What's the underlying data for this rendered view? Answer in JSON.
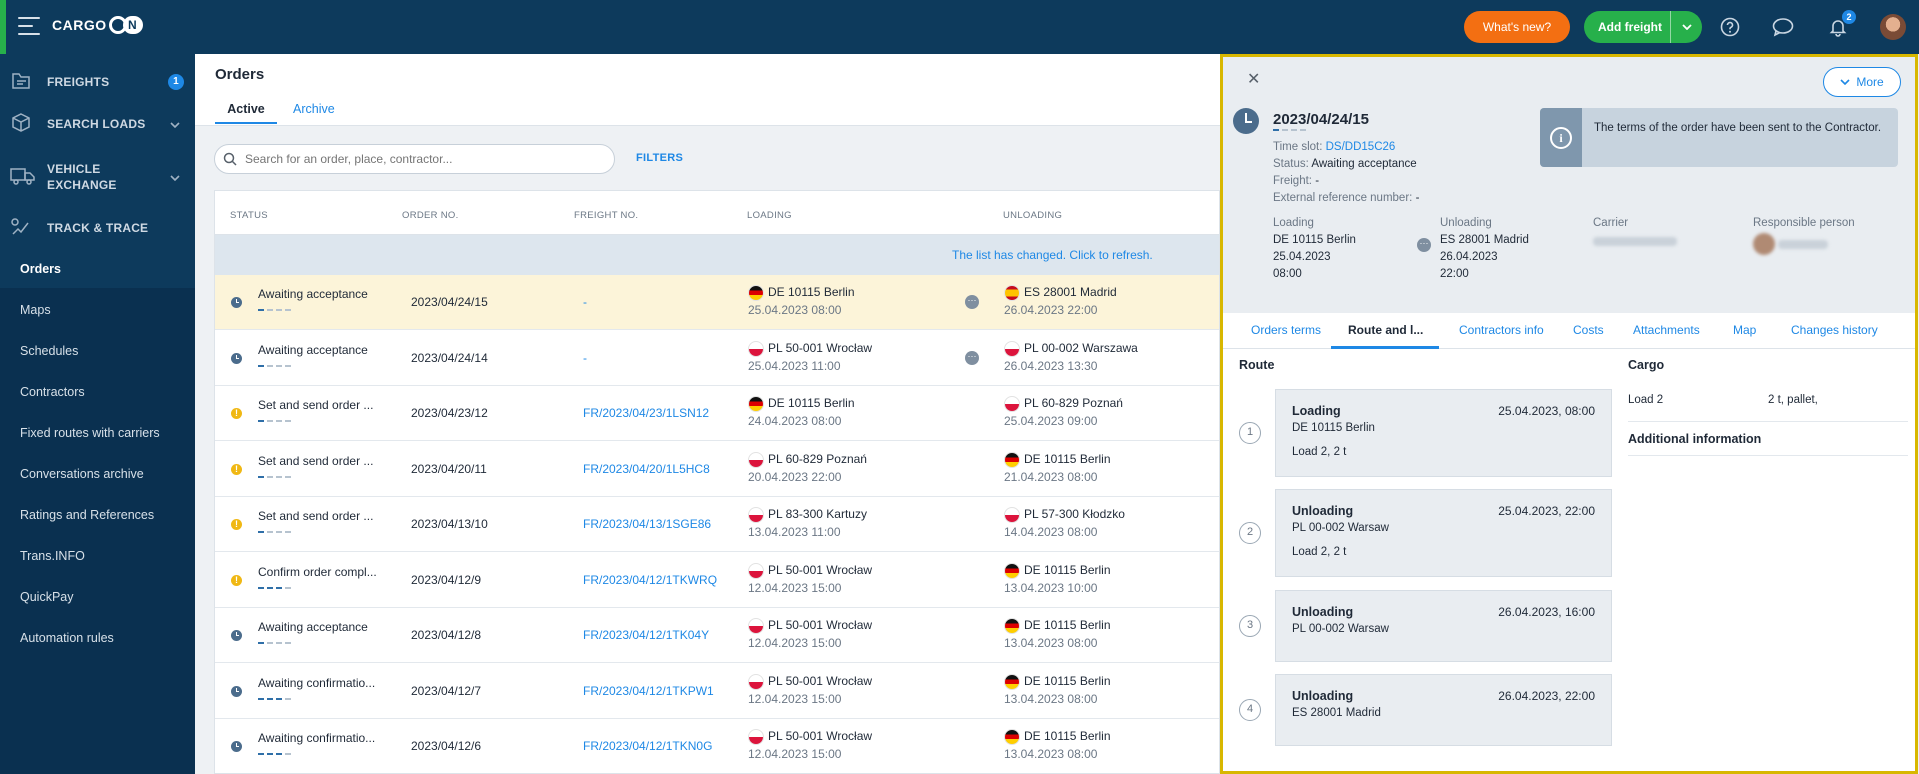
{
  "topbar": {
    "logo_text": "CARGO",
    "logo_on": "N",
    "whats_new": "What's new?",
    "add_freight": "Add freight",
    "notification_count": "2"
  },
  "sidebar": {
    "main": [
      {
        "label": "FREIGHTS",
        "badge": "1"
      },
      {
        "label": "SEARCH LOADS"
      },
      {
        "label": "VEHICLE EXCHANGE"
      },
      {
        "label": "TRACK & TRACE"
      }
    ],
    "sub": [
      "Orders",
      "Maps",
      "Schedules",
      "Contractors",
      "Fixed routes with carriers",
      "Conversations archive",
      "Ratings and References",
      "Trans.INFO",
      "QuickPay",
      "Automation rules"
    ]
  },
  "main": {
    "title": "Orders",
    "tabs": [
      "Active",
      "Archive"
    ],
    "search_placeholder": "Search for an order, place, contractor...",
    "filters": "FILTERS",
    "columns": [
      "STATUS",
      "ORDER NO.",
      "FREIGHT NO.",
      "LOADING",
      "UNLOADING"
    ],
    "refresh_text": "The list has changed. Click to refresh.",
    "rows": [
      {
        "status": "Awaiting acceptance",
        "icon": "clock",
        "order": "2023/04/24/15",
        "freight": "-",
        "lflag": "de",
        "load": "DE 10115 Berlin",
        "ldate": "25.04.2023 08:00",
        "uflag": "es",
        "unload": "ES 28001 Madrid",
        "udate": "26.04.2023 22:00",
        "dot": true
      },
      {
        "status": "Awaiting acceptance",
        "icon": "clock",
        "order": "2023/04/24/14",
        "freight": "-",
        "lflag": "pl",
        "load": "PL 50-001 Wrocław",
        "ldate": "25.04.2023 11:00",
        "uflag": "pl",
        "unload": "PL 00-002 Warszawa",
        "udate": "26.04.2023 13:30",
        "dot": true
      },
      {
        "status": "Set and send order ...",
        "icon": "warn",
        "order": "2023/04/23/12",
        "freight": "FR/2023/04/23/1LSN12",
        "lflag": "de",
        "load": "DE 10115 Berlin",
        "ldate": "24.04.2023 08:00",
        "uflag": "pl",
        "unload": "PL 60-829 Poznań",
        "udate": "25.04.2023 09:00",
        "dot": false
      },
      {
        "status": "Set and send order ...",
        "icon": "warn",
        "order": "2023/04/20/11",
        "freight": "FR/2023/04/20/1L5HC8",
        "lflag": "pl",
        "load": "PL 60-829 Poznań",
        "ldate": "20.04.2023 22:00",
        "uflag": "de",
        "unload": "DE 10115 Berlin",
        "udate": "21.04.2023 08:00",
        "dot": false
      },
      {
        "status": "Set and send order ...",
        "icon": "warn",
        "order": "2023/04/13/10",
        "freight": "FR/2023/04/13/1SGE86",
        "lflag": "pl",
        "load": "PL 83-300 Kartuzy",
        "ldate": "13.04.2023 11:00",
        "uflag": "pl",
        "unload": "PL 57-300 Kłodzko",
        "udate": "14.04.2023 08:00",
        "dot": false
      },
      {
        "status": "Confirm order compl...",
        "icon": "warn",
        "order": "2023/04/12/9",
        "freight": "FR/2023/04/12/1TKWRQ",
        "lflag": "pl",
        "load": "PL 50-001 Wrocław",
        "ldate": "12.04.2023 15:00",
        "uflag": "de",
        "unload": "DE 10115 Berlin",
        "udate": "13.04.2023 10:00",
        "dot": false
      },
      {
        "status": "Awaiting acceptance",
        "icon": "clock",
        "order": "2023/04/12/8",
        "freight": "FR/2023/04/12/1TK04Y",
        "lflag": "pl",
        "load": "PL 50-001 Wrocław",
        "ldate": "12.04.2023 15:00",
        "uflag": "de",
        "unload": "DE 10115 Berlin",
        "udate": "13.04.2023 08:00",
        "dot": false
      },
      {
        "status": "Awaiting confirmatio...",
        "icon": "clock",
        "order": "2023/04/12/7",
        "freight": "FR/2023/04/12/1TKPW1",
        "lflag": "pl",
        "load": "PL 50-001 Wrocław",
        "ldate": "12.04.2023 15:00",
        "uflag": "de",
        "unload": "DE 10115 Berlin",
        "udate": "13.04.2023 08:00",
        "dot": false
      },
      {
        "status": "Awaiting confirmatio...",
        "icon": "clock",
        "order": "2023/04/12/6",
        "freight": "FR/2023/04/12/1TKN0G",
        "lflag": "pl",
        "load": "PL 50-001 Wrocław",
        "ldate": "12.04.2023 15:00",
        "uflag": "de",
        "unload": "DE 10115 Berlin",
        "udate": "13.04.2023 08:00",
        "dot": false
      }
    ]
  },
  "panel": {
    "more": "More",
    "title": "2023/04/24/15",
    "time_slot_label": "Time slot:",
    "time_slot": "DS/DD15C26",
    "status_label": "Status:",
    "status": "Awaiting acceptance",
    "freight_label": "Freight:",
    "freight": "-",
    "extref_label": "External reference number:",
    "extref": "-",
    "notice": "The terms of the order have been sent to the Contractor.",
    "loading_label": "Loading",
    "loading_lines": [
      "DE 10115 Berlin",
      "25.04.2023",
      "08:00"
    ],
    "unloading_label": "Unloading",
    "unloading_lines": [
      "ES 28001 Madrid",
      "26.04.2023",
      "22:00"
    ],
    "carrier_label": "Carrier",
    "responsible_label": "Responsible person",
    "tabs": [
      "Orders terms",
      "Route and l...",
      "Contractors info",
      "Costs",
      "Attachments",
      "Map",
      "Changes history"
    ],
    "route_title": "Route",
    "cargo_title": "Cargo",
    "steps": [
      {
        "num": "1",
        "type": "Loading",
        "date": "25.04.2023, 08:00",
        "place": "DE 10115 Berlin",
        "load": "Load 2, 2 t"
      },
      {
        "num": "2",
        "type": "Unloading",
        "date": "25.04.2023, 22:00",
        "place": "PL 00-002 Warsaw",
        "load": "Load 2, 2 t"
      },
      {
        "num": "3",
        "type": "Unloading",
        "date": "26.04.2023, 16:00",
        "place": "PL 00-002 Warsaw",
        "load": ""
      },
      {
        "num": "4",
        "type": "Unloading",
        "date": "26.04.2023, 22:00",
        "place": "ES 28001 Madrid",
        "load": ""
      }
    ],
    "cargo": {
      "name": "Load 2",
      "value": "2 t, pallet,"
    },
    "additional_info": "Additional information"
  }
}
